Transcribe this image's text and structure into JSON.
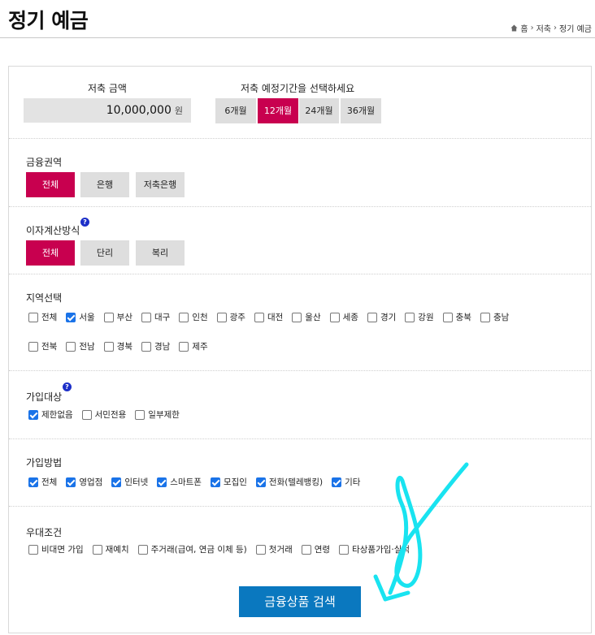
{
  "header": {
    "title": "정기 예금",
    "breadcrumb": [
      "홈",
      "저축",
      "정기 예금"
    ]
  },
  "amount": {
    "label": "저축 금액",
    "value": "10,000,000",
    "unit": "원"
  },
  "period": {
    "label": "저축 예정기간을 선택하세요",
    "options": [
      "6개월",
      "12개월",
      "24개월",
      "36개월"
    ],
    "selected": "12개월"
  },
  "finance_area": {
    "label": "금융권역",
    "options": [
      "전체",
      "은행",
      "저축은행"
    ],
    "selected": "전체"
  },
  "interest_method": {
    "label": "이자계산방식",
    "help": "?",
    "options": [
      "전체",
      "단리",
      "복리"
    ],
    "selected": "전체"
  },
  "region": {
    "label": "지역선택",
    "row1": [
      {
        "label": "전체",
        "checked": false
      },
      {
        "label": "서울",
        "checked": true
      },
      {
        "label": "부산",
        "checked": false
      },
      {
        "label": "대구",
        "checked": false
      },
      {
        "label": "인천",
        "checked": false
      },
      {
        "label": "광주",
        "checked": false
      },
      {
        "label": "대전",
        "checked": false
      },
      {
        "label": "울산",
        "checked": false
      },
      {
        "label": "세종",
        "checked": false
      },
      {
        "label": "경기",
        "checked": false
      },
      {
        "label": "강원",
        "checked": false
      },
      {
        "label": "충북",
        "checked": false
      },
      {
        "label": "충남",
        "checked": false
      }
    ],
    "row2": [
      {
        "label": "전북",
        "checked": false
      },
      {
        "label": "전남",
        "checked": false
      },
      {
        "label": "경북",
        "checked": false
      },
      {
        "label": "경남",
        "checked": false
      },
      {
        "label": "제주",
        "checked": false
      }
    ]
  },
  "target": {
    "label": "가입대상",
    "help": "?",
    "items": [
      {
        "label": "제한없음",
        "checked": true
      },
      {
        "label": "서민전용",
        "checked": false
      },
      {
        "label": "일부제한",
        "checked": false
      }
    ]
  },
  "join_method": {
    "label": "가입방법",
    "items": [
      {
        "label": "전체",
        "checked": true
      },
      {
        "label": "영업점",
        "checked": true
      },
      {
        "label": "인터넷",
        "checked": true
      },
      {
        "label": "스마트폰",
        "checked": true
      },
      {
        "label": "모집인",
        "checked": true
      },
      {
        "label": "전화(텔레뱅킹)",
        "checked": true
      },
      {
        "label": "기타",
        "checked": true
      }
    ]
  },
  "preference": {
    "label": "우대조건",
    "items": [
      {
        "label": "비대면 가입",
        "checked": false
      },
      {
        "label": "재예치",
        "checked": false
      },
      {
        "label": "주거래(급여, 연금 이체 등)",
        "checked": false
      },
      {
        "label": "첫거래",
        "checked": false
      },
      {
        "label": "연령",
        "checked": false
      },
      {
        "label": "타상품가입·실적",
        "checked": false
      }
    ]
  },
  "search_button": "금융상품 검색",
  "colors": {
    "selected": "#c8004f",
    "unselected": "#dedede",
    "primary": "#0a78bf",
    "checkbox": "#1a73e8",
    "annotation": "#19e3f0"
  }
}
